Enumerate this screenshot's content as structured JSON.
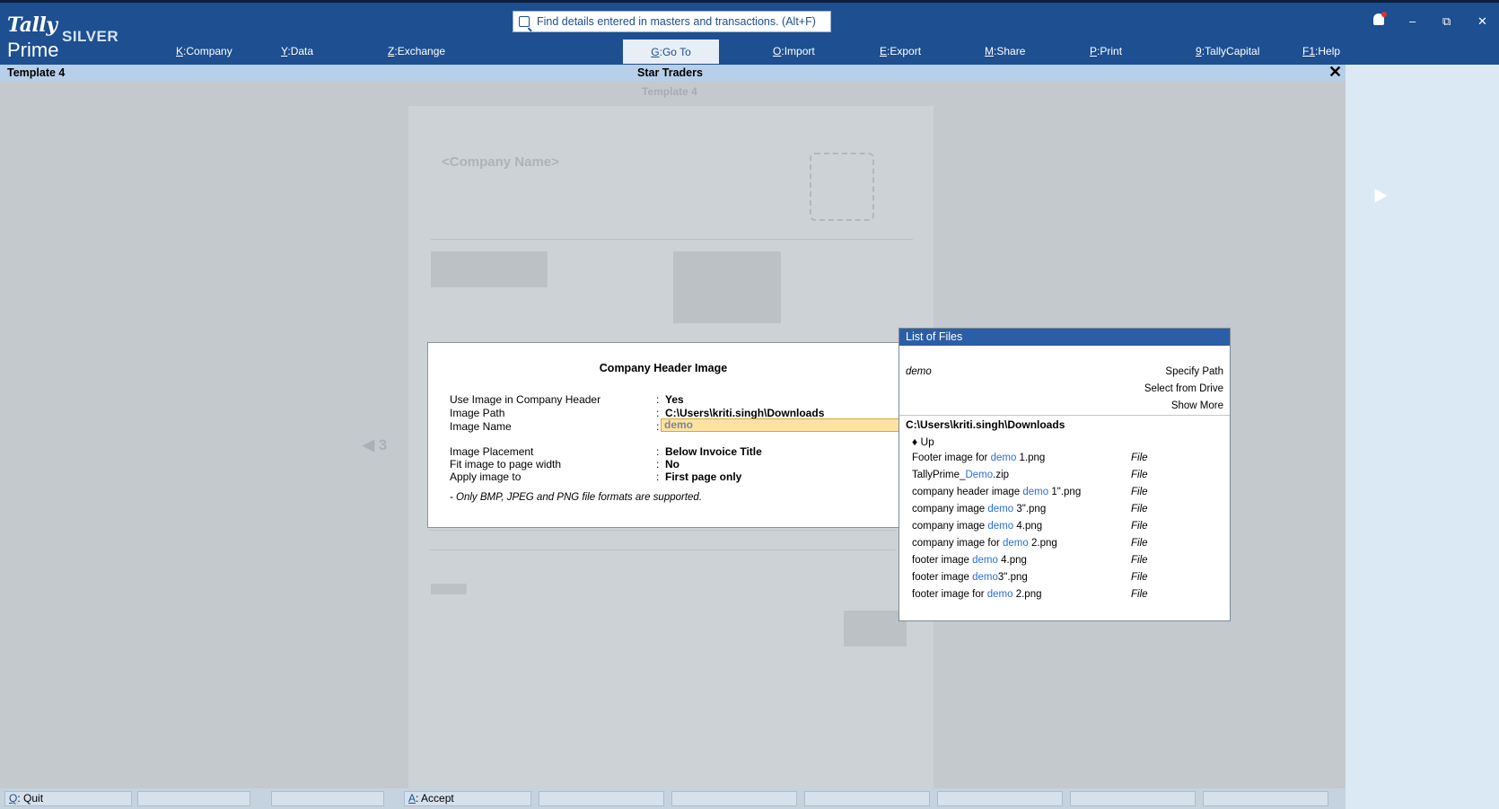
{
  "app": {
    "logo_tally": "Tally",
    "logo_prime": "Prime",
    "edition": "SILVER"
  },
  "search": {
    "placeholder": "Find details entered in masters and transactions. (Alt+F)"
  },
  "menu": [
    {
      "key": "K",
      "label": "Company"
    },
    {
      "key": "Y",
      "label": "Data"
    },
    {
      "key": "Z",
      "label": "Exchange"
    },
    {
      "key": "G",
      "label": "Go To"
    },
    {
      "key": "O",
      "label": "Import"
    },
    {
      "key": "E",
      "label": "Export"
    },
    {
      "key": "M",
      "label": "Share"
    },
    {
      "key": "P",
      "label": "Print"
    },
    {
      "key": "9",
      "label": "TallyCapital"
    },
    {
      "key": "F1",
      "label": "Help"
    }
  ],
  "window": {
    "minimize": "–",
    "restore": "⧉",
    "close": "✕"
  },
  "titlebar": {
    "report": "Template 4",
    "company": "Star Traders",
    "close": "✕"
  },
  "preview": {
    "title": "Template 4",
    "company_placeholder": "<Company Name>",
    "page_nav": "◀ 3"
  },
  "dialog": {
    "title": "Company Header Image",
    "rows": [
      {
        "label": "Use Image in Company Header",
        "value": "Yes"
      },
      {
        "label": "Image Path",
        "value": "C:\\Users\\kriti.singh\\Downloads"
      },
      {
        "label": "Image Name",
        "value": "demo"
      },
      {
        "label": "Image Placement",
        "value": "Below Invoice Title"
      },
      {
        "label": "Fit image to page width",
        "value": "No"
      },
      {
        "label": "Apply image to",
        "value": "First page only"
      }
    ],
    "note": "- Only BMP, JPEG and PNG file formats are supported."
  },
  "file_list": {
    "title": "List of Files",
    "search_term": "demo",
    "actions": [
      "Specify Path",
      "Select from Drive",
      "Show More"
    ],
    "path": "C:\\Users\\kriti.singh\\Downloads",
    "up": "♦ Up",
    "files": [
      {
        "pre": "Footer image for ",
        "hl": "demo",
        "post": " 1.png",
        "type": "File"
      },
      {
        "pre": "TallyPrime_",
        "hl": "Demo",
        "post": ".zip",
        "type": "File"
      },
      {
        "pre": "company header image ",
        "hl": "demo",
        "post": " 1\".png",
        "type": "File"
      },
      {
        "pre": "company image ",
        "hl": "demo",
        "post": " 3\".png",
        "type": "File"
      },
      {
        "pre": "company image ",
        "hl": "demo",
        "post": " 4.png",
        "type": "File"
      },
      {
        "pre": "company image for ",
        "hl": "demo",
        "post": " 2.png",
        "type": "File"
      },
      {
        "pre": "footer image ",
        "hl": "demo",
        "post": " 4.png",
        "type": "File"
      },
      {
        "pre": "footer image ",
        "hl": "demo",
        "post": "3\".png",
        "type": "File"
      },
      {
        "pre": "footer image for ",
        "hl": "demo",
        "post": " 2.png",
        "type": "File"
      }
    ]
  },
  "bottom_bar": [
    {
      "key": "Q",
      "label": "Quit"
    },
    {
      "key": "A",
      "label": "Accept"
    }
  ]
}
